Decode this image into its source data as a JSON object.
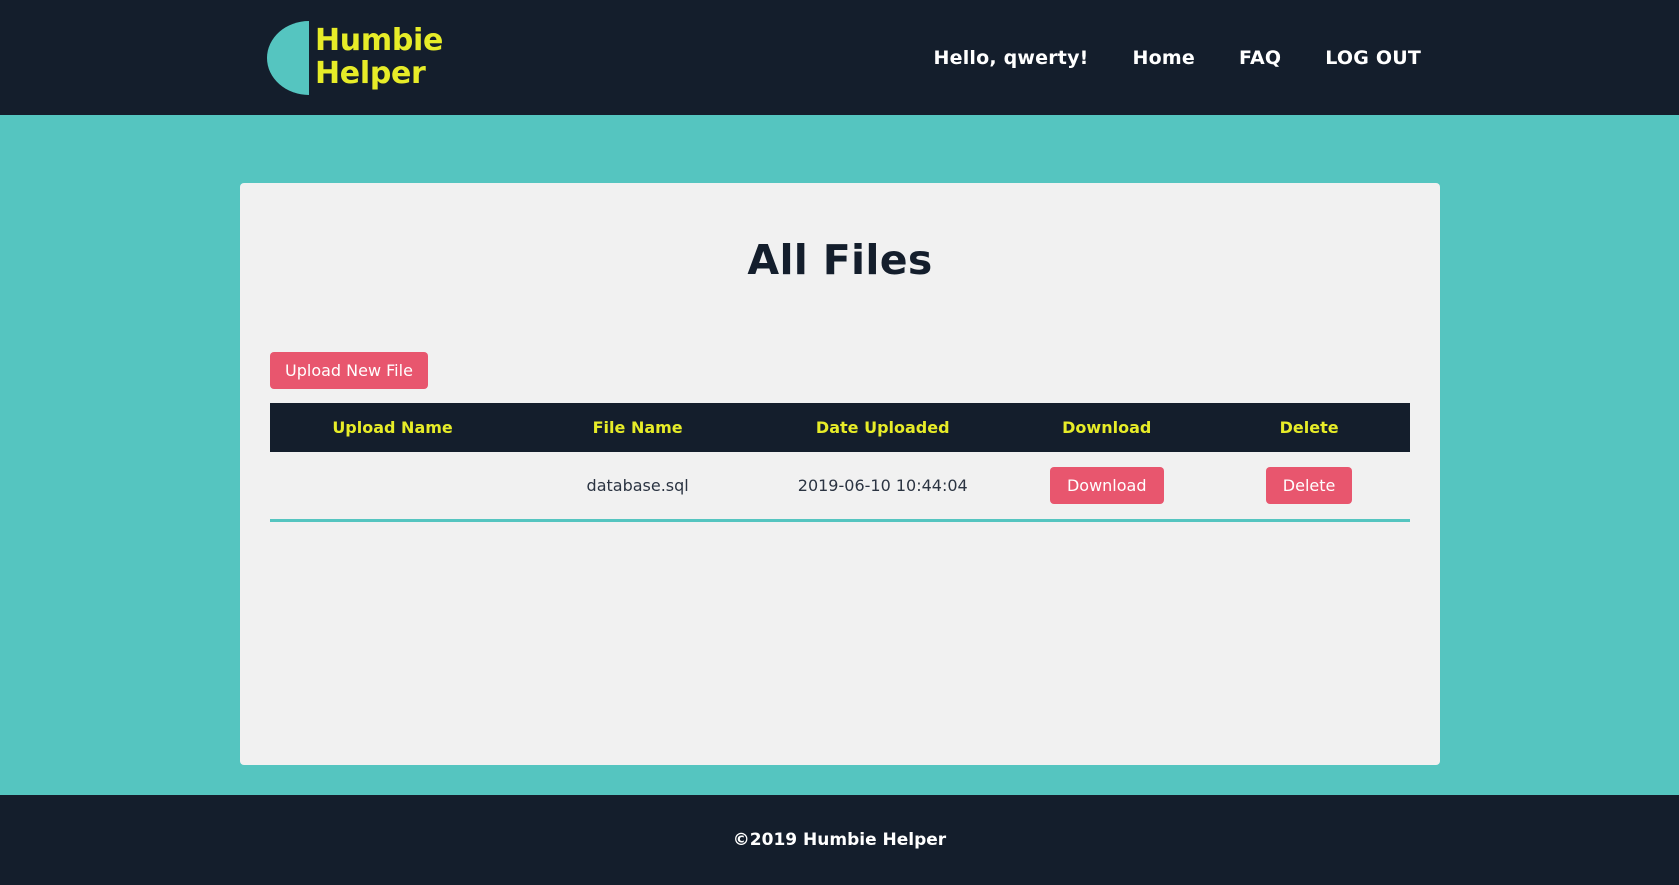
{
  "theme": {
    "navy": "#141e2c",
    "teal": "#55c5c0",
    "yellow": "#e7ec28",
    "pink": "#e8566e",
    "card_bg": "#f1f1f1"
  },
  "navbar": {
    "brand_line1": "Humbie",
    "brand_line2": "Helper",
    "logo_icon": "half-circle-logo",
    "links": [
      {
        "label": "Hello, qwerty!",
        "name": "nav-greeting"
      },
      {
        "label": "Home",
        "name": "nav-home"
      },
      {
        "label": "FAQ",
        "name": "nav-faq"
      },
      {
        "label": "LOG OUT",
        "name": "nav-logout"
      }
    ]
  },
  "main": {
    "page_title": "All Files",
    "upload_button_label": "Upload New File",
    "table": {
      "columns": [
        "Upload Name",
        "File Name",
        "Date Uploaded",
        "Download",
        "Delete"
      ],
      "rows": [
        {
          "upload_name": "",
          "file_name": "database.sql",
          "date_uploaded": "2019-06-10 10:44:04",
          "download_label": "Download",
          "delete_label": "Delete"
        }
      ]
    }
  },
  "footer": {
    "copyright": "©2019 Humbie Helper"
  }
}
